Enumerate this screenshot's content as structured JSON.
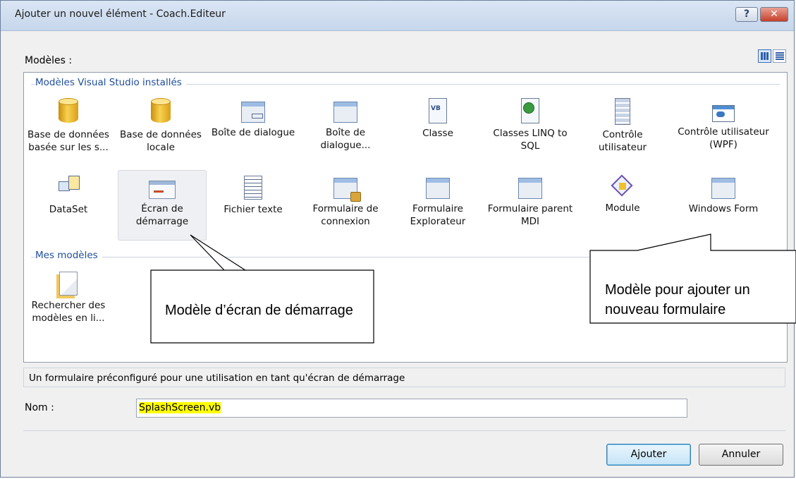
{
  "window": {
    "title": "Ajouter un nouvel élément - Coach.Editeur",
    "help_label": "?",
    "close_label": "✕"
  },
  "models_label": "Modèles :",
  "sections": {
    "installed": {
      "title": "Modèles Visual Studio installés",
      "items": [
        {
          "label": "Base de données basée sur les s...",
          "icon": "database-icon"
        },
        {
          "label": "Base de données locale",
          "icon": "database-icon"
        },
        {
          "label": "Boîte de dialogue",
          "icon": "dialog-icon"
        },
        {
          "label": "Boîte de dialogue...",
          "icon": "about-dialog-icon"
        },
        {
          "label": "Classe",
          "icon": "class-icon"
        },
        {
          "label": "Classes LINQ to SQL",
          "icon": "linq-icon"
        },
        {
          "label": "Contrôle utilisateur",
          "icon": "user-control-icon"
        },
        {
          "label": "Contrôle utilisateur (WPF)",
          "icon": "wpf-control-icon"
        },
        {
          "label": "DataSet",
          "icon": "dataset-icon"
        },
        {
          "label": "Écran de démarrage",
          "icon": "splash-screen-icon",
          "selected": true
        },
        {
          "label": "Fichier texte",
          "icon": "text-file-icon"
        },
        {
          "label": "Formulaire de connexion",
          "icon": "login-form-icon"
        },
        {
          "label": "Formulaire Explorateur",
          "icon": "explorer-form-icon"
        },
        {
          "label": "Formulaire parent MDI",
          "icon": "mdi-form-icon"
        },
        {
          "label": "Module",
          "icon": "module-icon"
        },
        {
          "label": "Windows Form",
          "icon": "windows-form-icon"
        }
      ]
    },
    "mine": {
      "title": "Mes modèles",
      "items": [
        {
          "label": "Rechercher des modèles en li...",
          "icon": "search-online-icon"
        }
      ]
    }
  },
  "callouts": {
    "splash": "Modèle d’écran de démarrage",
    "form": "Modèle pour ajouter un nouveau formulaire"
  },
  "description": "Un formulaire préconfiguré pour une utilisation en tant qu'écran de démarrage",
  "name_label": "Nom :",
  "name_value": "SplashScreen.vb",
  "buttons": {
    "add": "Ajouter",
    "cancel": "Annuler"
  },
  "colors": {
    "section_title": "#1e4d9b",
    "highlight": "#ffff00",
    "titlebar": "#c6d6ec"
  }
}
